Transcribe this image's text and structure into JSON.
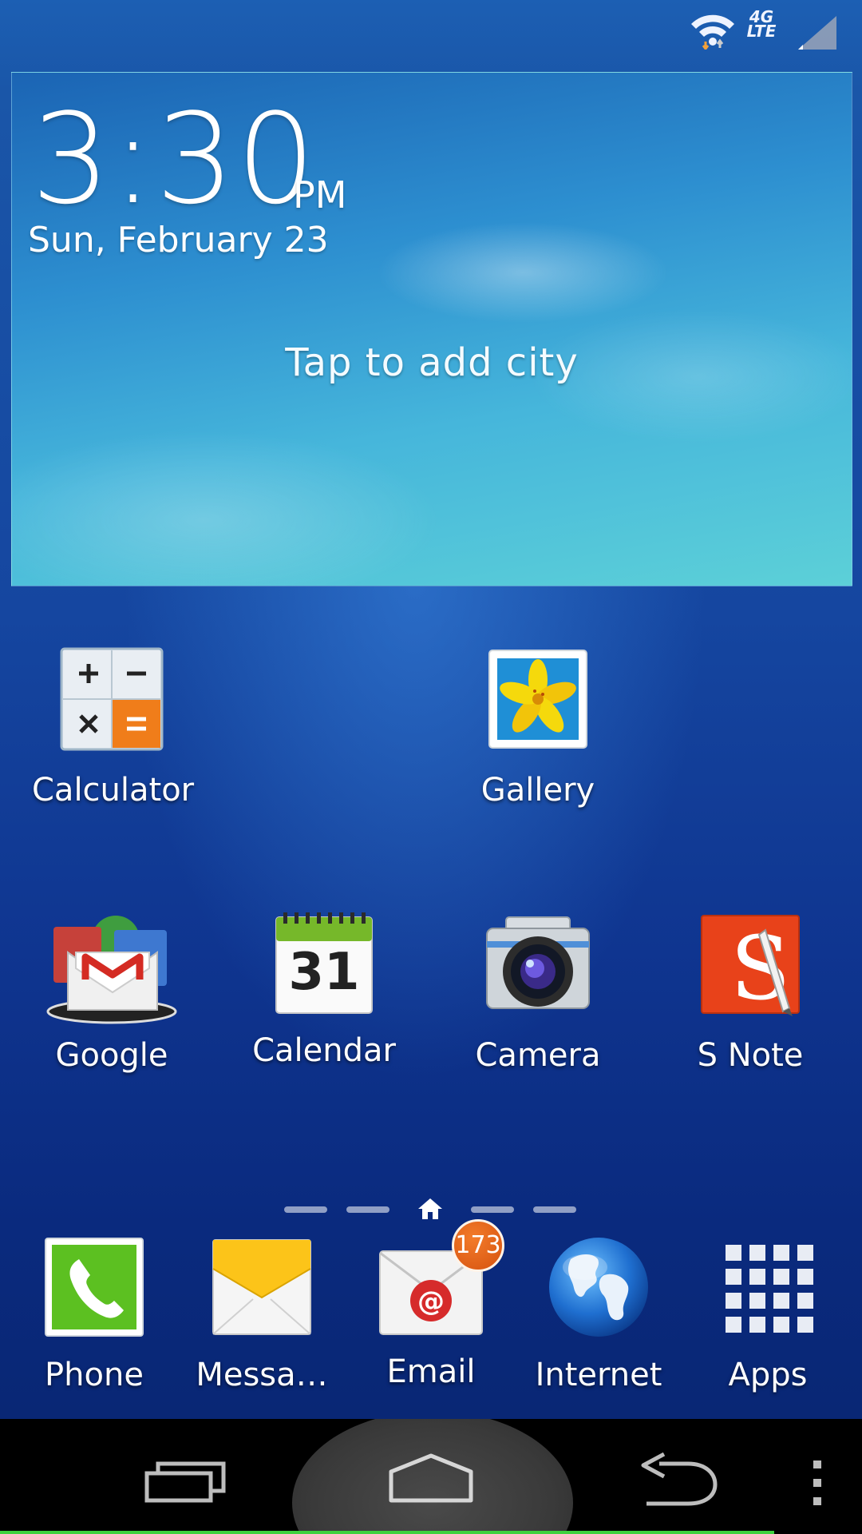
{
  "status_bar": {
    "network": "4G",
    "network_sub": "LTE",
    "icons": [
      "wifi-icon",
      "lte-icon",
      "signal-icon"
    ]
  },
  "weather_widget": {
    "time": "3:30",
    "ampm": "PM",
    "date": "Sun, February 23",
    "prompt": "Tap to add city"
  },
  "home_apps": [
    {
      "label": "Calculator",
      "icon": "calculator-icon"
    },
    {
      "label": "Gallery",
      "icon": "gallery-icon"
    },
    {
      "label": "Google",
      "icon": "google-folder-icon"
    },
    {
      "label": "Calendar",
      "icon": "calendar-icon",
      "day": "31"
    },
    {
      "label": "Camera",
      "icon": "camera-icon"
    },
    {
      "label": "S Note",
      "icon": "s-note-icon"
    }
  ],
  "page_indicator": {
    "pages": 5,
    "home_page": 3
  },
  "dock": [
    {
      "label": "Phone",
      "icon": "phone-icon"
    },
    {
      "label": "Messa…",
      "icon": "messages-icon"
    },
    {
      "label": "Email",
      "icon": "email-icon",
      "badge": "173"
    },
    {
      "label": "Internet",
      "icon": "internet-globe-icon"
    },
    {
      "label": "Apps",
      "icon": "apps-grid-icon"
    }
  ],
  "nav_bar": {
    "buttons": [
      "recent-apps-icon",
      "home-icon",
      "back-icon",
      "menu-icon"
    ]
  },
  "colors": {
    "accent_green": "#3ed13e",
    "badge_orange": "#e05a10",
    "wallpaper_blue": "#1546a0"
  }
}
